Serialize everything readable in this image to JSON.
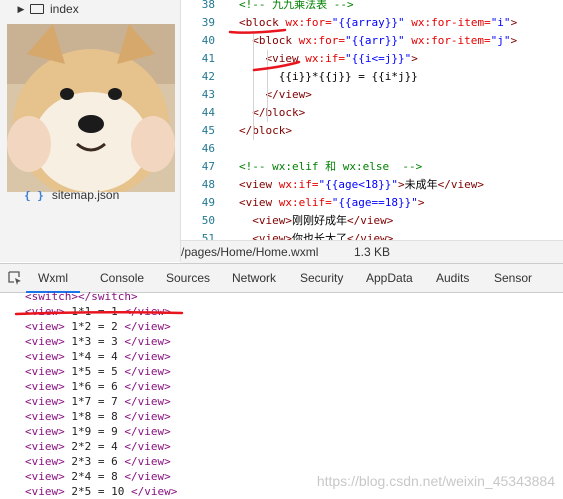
{
  "filetree": {
    "folder_label": "index",
    "file_label": "sitemap.json"
  },
  "editor": {
    "lines": [
      {
        "n": "38",
        "parts": [
          {
            "c": "cmt",
            "t": "<!-- 九九乘法表 -->"
          }
        ]
      },
      {
        "n": "39",
        "parts": [
          {
            "c": "tag",
            "t": "<block"
          },
          {
            "c": "attr",
            "t": " wx:for="
          },
          {
            "c": "str",
            "t": "\"{{array}}\""
          },
          {
            "c": "attr",
            "t": " wx:for-item="
          },
          {
            "c": "str",
            "t": "\"i\""
          },
          {
            "c": "tag",
            "t": ">"
          }
        ]
      },
      {
        "n": "40",
        "parts": [
          {
            "c": "tag",
            "t": "  <block"
          },
          {
            "c": "attr",
            "t": " wx:for="
          },
          {
            "c": "str",
            "t": "\"{{arr}}\""
          },
          {
            "c": "attr",
            "t": " wx:for-item="
          },
          {
            "c": "str",
            "t": "\"j\""
          },
          {
            "c": "tag",
            "t": ">"
          }
        ]
      },
      {
        "n": "41",
        "parts": [
          {
            "c": "tag",
            "t": "    <view"
          },
          {
            "c": "attr",
            "t": " wx:if="
          },
          {
            "c": "str",
            "t": "\"{{i<=j}}\""
          },
          {
            "c": "tag",
            "t": ">"
          }
        ]
      },
      {
        "n": "42",
        "parts": [
          {
            "c": "txt",
            "t": "      {{i}}*{{j}} = {{i*j}}"
          }
        ]
      },
      {
        "n": "43",
        "parts": [
          {
            "c": "tag",
            "t": "    </view>"
          }
        ]
      },
      {
        "n": "44",
        "parts": [
          {
            "c": "tag",
            "t": "  </block>"
          }
        ]
      },
      {
        "n": "45",
        "parts": [
          {
            "c": "tag",
            "t": "</block>"
          }
        ]
      },
      {
        "n": "46",
        "parts": [
          {
            "c": "txt",
            "t": ""
          }
        ]
      },
      {
        "n": "47",
        "parts": [
          {
            "c": "cmt",
            "t": "<!-- wx:elif 和 wx:else  -->"
          }
        ]
      },
      {
        "n": "48",
        "parts": [
          {
            "c": "tag",
            "t": "<view"
          },
          {
            "c": "attr",
            "t": " wx:if="
          },
          {
            "c": "str",
            "t": "\"{{age<18}}\""
          },
          {
            "c": "tag",
            "t": ">"
          },
          {
            "c": "txt",
            "t": "未成年"
          },
          {
            "c": "tag",
            "t": "</view>"
          }
        ]
      },
      {
        "n": "49",
        "parts": [
          {
            "c": "tag",
            "t": "<view"
          },
          {
            "c": "attr",
            "t": " wx:elif="
          },
          {
            "c": "str",
            "t": "\"{{age==18}}\""
          },
          {
            "c": "tag",
            "t": ">"
          }
        ]
      },
      {
        "n": "50",
        "parts": [
          {
            "c": "tag",
            "t": "  <view>"
          },
          {
            "c": "txt",
            "t": "刚刚好成年"
          },
          {
            "c": "tag",
            "t": "</view>"
          }
        ]
      },
      {
        "n": "51",
        "parts": [
          {
            "c": "tag",
            "t": "  <view>"
          },
          {
            "c": "txt",
            "t": "你也长大了"
          },
          {
            "c": "tag",
            "t": "</view>"
          }
        ]
      }
    ]
  },
  "statusbar": {
    "path": "/pages/Home/Home.wxml",
    "size": "1.3 KB"
  },
  "devtools": {
    "tabs": [
      "Wxml",
      "Console",
      "Sources",
      "Network",
      "Security",
      "AppData",
      "Audits",
      "Sensor"
    ],
    "active_tab": "Wxml"
  },
  "console": {
    "lines": [
      {
        "open": "<switch>",
        "text": "",
        "close": "</switch>"
      },
      {
        "open": "<view>",
        "text": " 1*1 = 1 ",
        "close": "</view>"
      },
      {
        "open": "<view>",
        "text": " 1*2 = 2 ",
        "close": "</view>"
      },
      {
        "open": "<view>",
        "text": " 1*3 = 3 ",
        "close": "</view>"
      },
      {
        "open": "<view>",
        "text": " 1*4 = 4 ",
        "close": "</view>"
      },
      {
        "open": "<view>",
        "text": " 1*5 = 5 ",
        "close": "</view>"
      },
      {
        "open": "<view>",
        "text": " 1*6 = 6 ",
        "close": "</view>"
      },
      {
        "open": "<view>",
        "text": " 1*7 = 7 ",
        "close": "</view>"
      },
      {
        "open": "<view>",
        "text": " 1*8 = 8 ",
        "close": "</view>"
      },
      {
        "open": "<view>",
        "text": " 1*9 = 9 ",
        "close": "</view>"
      },
      {
        "open": "<view>",
        "text": " 2*2 = 4 ",
        "close": "</view>"
      },
      {
        "open": "<view>",
        "text": " 2*3 = 6 ",
        "close": "</view>"
      },
      {
        "open": "<view>",
        "text": " 2*4 = 8 ",
        "close": "</view>"
      },
      {
        "open": "<view>",
        "text": " 2*5 = 10 ",
        "close": "</view>"
      }
    ]
  },
  "watermark": "https://blog.csdn.net/weixin_45343884",
  "colors": {
    "annotation_red": "#e8141e",
    "active_tab_underline": "#1a73e8"
  }
}
